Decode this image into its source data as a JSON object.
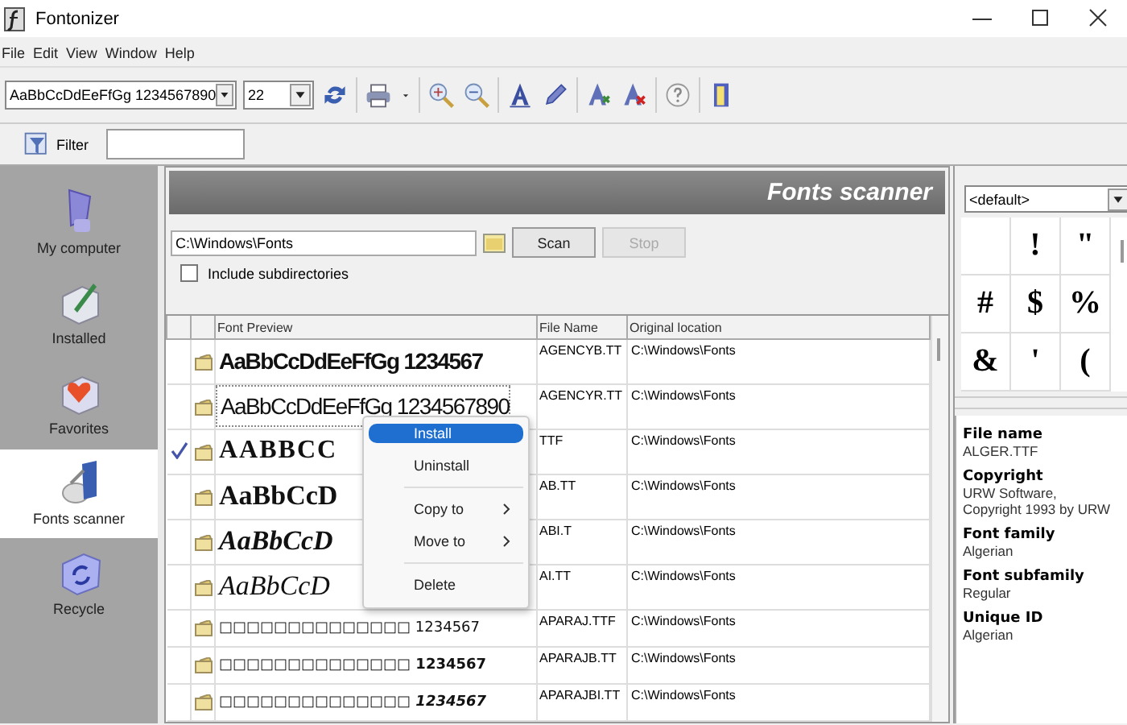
{
  "window": {
    "title": "Fontonizer"
  },
  "menu": [
    "File",
    "Edit",
    "View",
    "Window",
    "Help"
  ],
  "toolbar": {
    "preview_text": "AaBbCcDdEeFfGg 1234567890",
    "size": "22"
  },
  "filter": {
    "label": "Filter"
  },
  "sidebar": {
    "items": [
      {
        "label": "My computer",
        "kind": "computer",
        "selected": false
      },
      {
        "label": "Installed",
        "kind": "installed",
        "selected": false
      },
      {
        "label": "Favorites",
        "kind": "favorites",
        "selected": false
      },
      {
        "label": "Fonts scanner",
        "kind": "scanner",
        "selected": true
      },
      {
        "label": "Recycle",
        "kind": "recycle",
        "selected": false
      }
    ]
  },
  "scanner": {
    "title": "Fonts scanner",
    "path": "C:\\Windows\\Fonts",
    "scan_button": "Scan",
    "stop_button": "Stop",
    "stop_disabled": true,
    "include_subdirectories": {
      "label": "Include subdirectories",
      "checked": false
    }
  },
  "table": {
    "columns": [
      "Font Preview",
      "File Name",
      "Original location"
    ],
    "rows": [
      {
        "checked": false,
        "preview": "AaBbCcDdEeFfGg 1234567",
        "file": "AGENCYB.TT",
        "location": "C:\\Windows\\Fonts"
      },
      {
        "checked": false,
        "preview": "AaBbCcDdEeFfGg 1234567890",
        "file": "AGENCYR.TT",
        "location": "C:\\Windows\\Fonts"
      },
      {
        "checked": true,
        "preview": "AABBCC",
        "file": "TTF",
        "location": "C:\\Windows\\Fonts"
      },
      {
        "checked": false,
        "preview": "AaBbCcD",
        "file": "AB.TT",
        "location": "C:\\Windows\\Fonts"
      },
      {
        "checked": false,
        "preview": "AaBbCcD",
        "file": "ABI.T",
        "location": "C:\\Windows\\Fonts"
      },
      {
        "checked": false,
        "preview": "AaBbCcD",
        "file": "AI.TT",
        "location": "C:\\Windows\\Fonts"
      },
      {
        "checked": false,
        "preview": "□□□□□□□□□□□□□□ 1234567",
        "file": "APARAJ.TTF",
        "location": "C:\\Windows\\Fonts"
      },
      {
        "checked": false,
        "preview": "□□□□□□□□□□□□□□ 1234567",
        "file": "APARAJB.TT",
        "location": "C:\\Windows\\Fonts"
      },
      {
        "checked": false,
        "preview": "□□□□□□□□□□□□□□ 1234567",
        "file": "APARAJBI.TT",
        "location": "C:\\Windows\\Fonts"
      }
    ]
  },
  "context_menu": {
    "items": [
      {
        "kind": "item",
        "label": "Install",
        "selected": true,
        "submenu": false
      },
      {
        "kind": "item",
        "label": "Uninstall",
        "selected": false,
        "submenu": false
      },
      {
        "kind": "separator"
      },
      {
        "kind": "item",
        "label": "Copy to",
        "selected": false,
        "submenu": true
      },
      {
        "kind": "item",
        "label": "Move to",
        "selected": false,
        "submenu": true
      },
      {
        "kind": "separator"
      },
      {
        "kind": "item",
        "label": "Delete",
        "selected": false,
        "submenu": false
      }
    ]
  },
  "charset": {
    "value": "<default>",
    "chars": [
      "!",
      "\"",
      "#",
      "$",
      "%",
      "&",
      "'",
      "("
    ]
  },
  "properties": [
    {
      "name": "File name",
      "value": "ALGER.TTF"
    },
    {
      "name": "Copyright",
      "value": "URW Software, Copyright 1993 by URW"
    },
    {
      "name": "Font family",
      "value": "Algerian"
    },
    {
      "name": "Font subfamily",
      "value": "Regular"
    },
    {
      "name": "Unique ID",
      "value": "Algerian"
    }
  ]
}
